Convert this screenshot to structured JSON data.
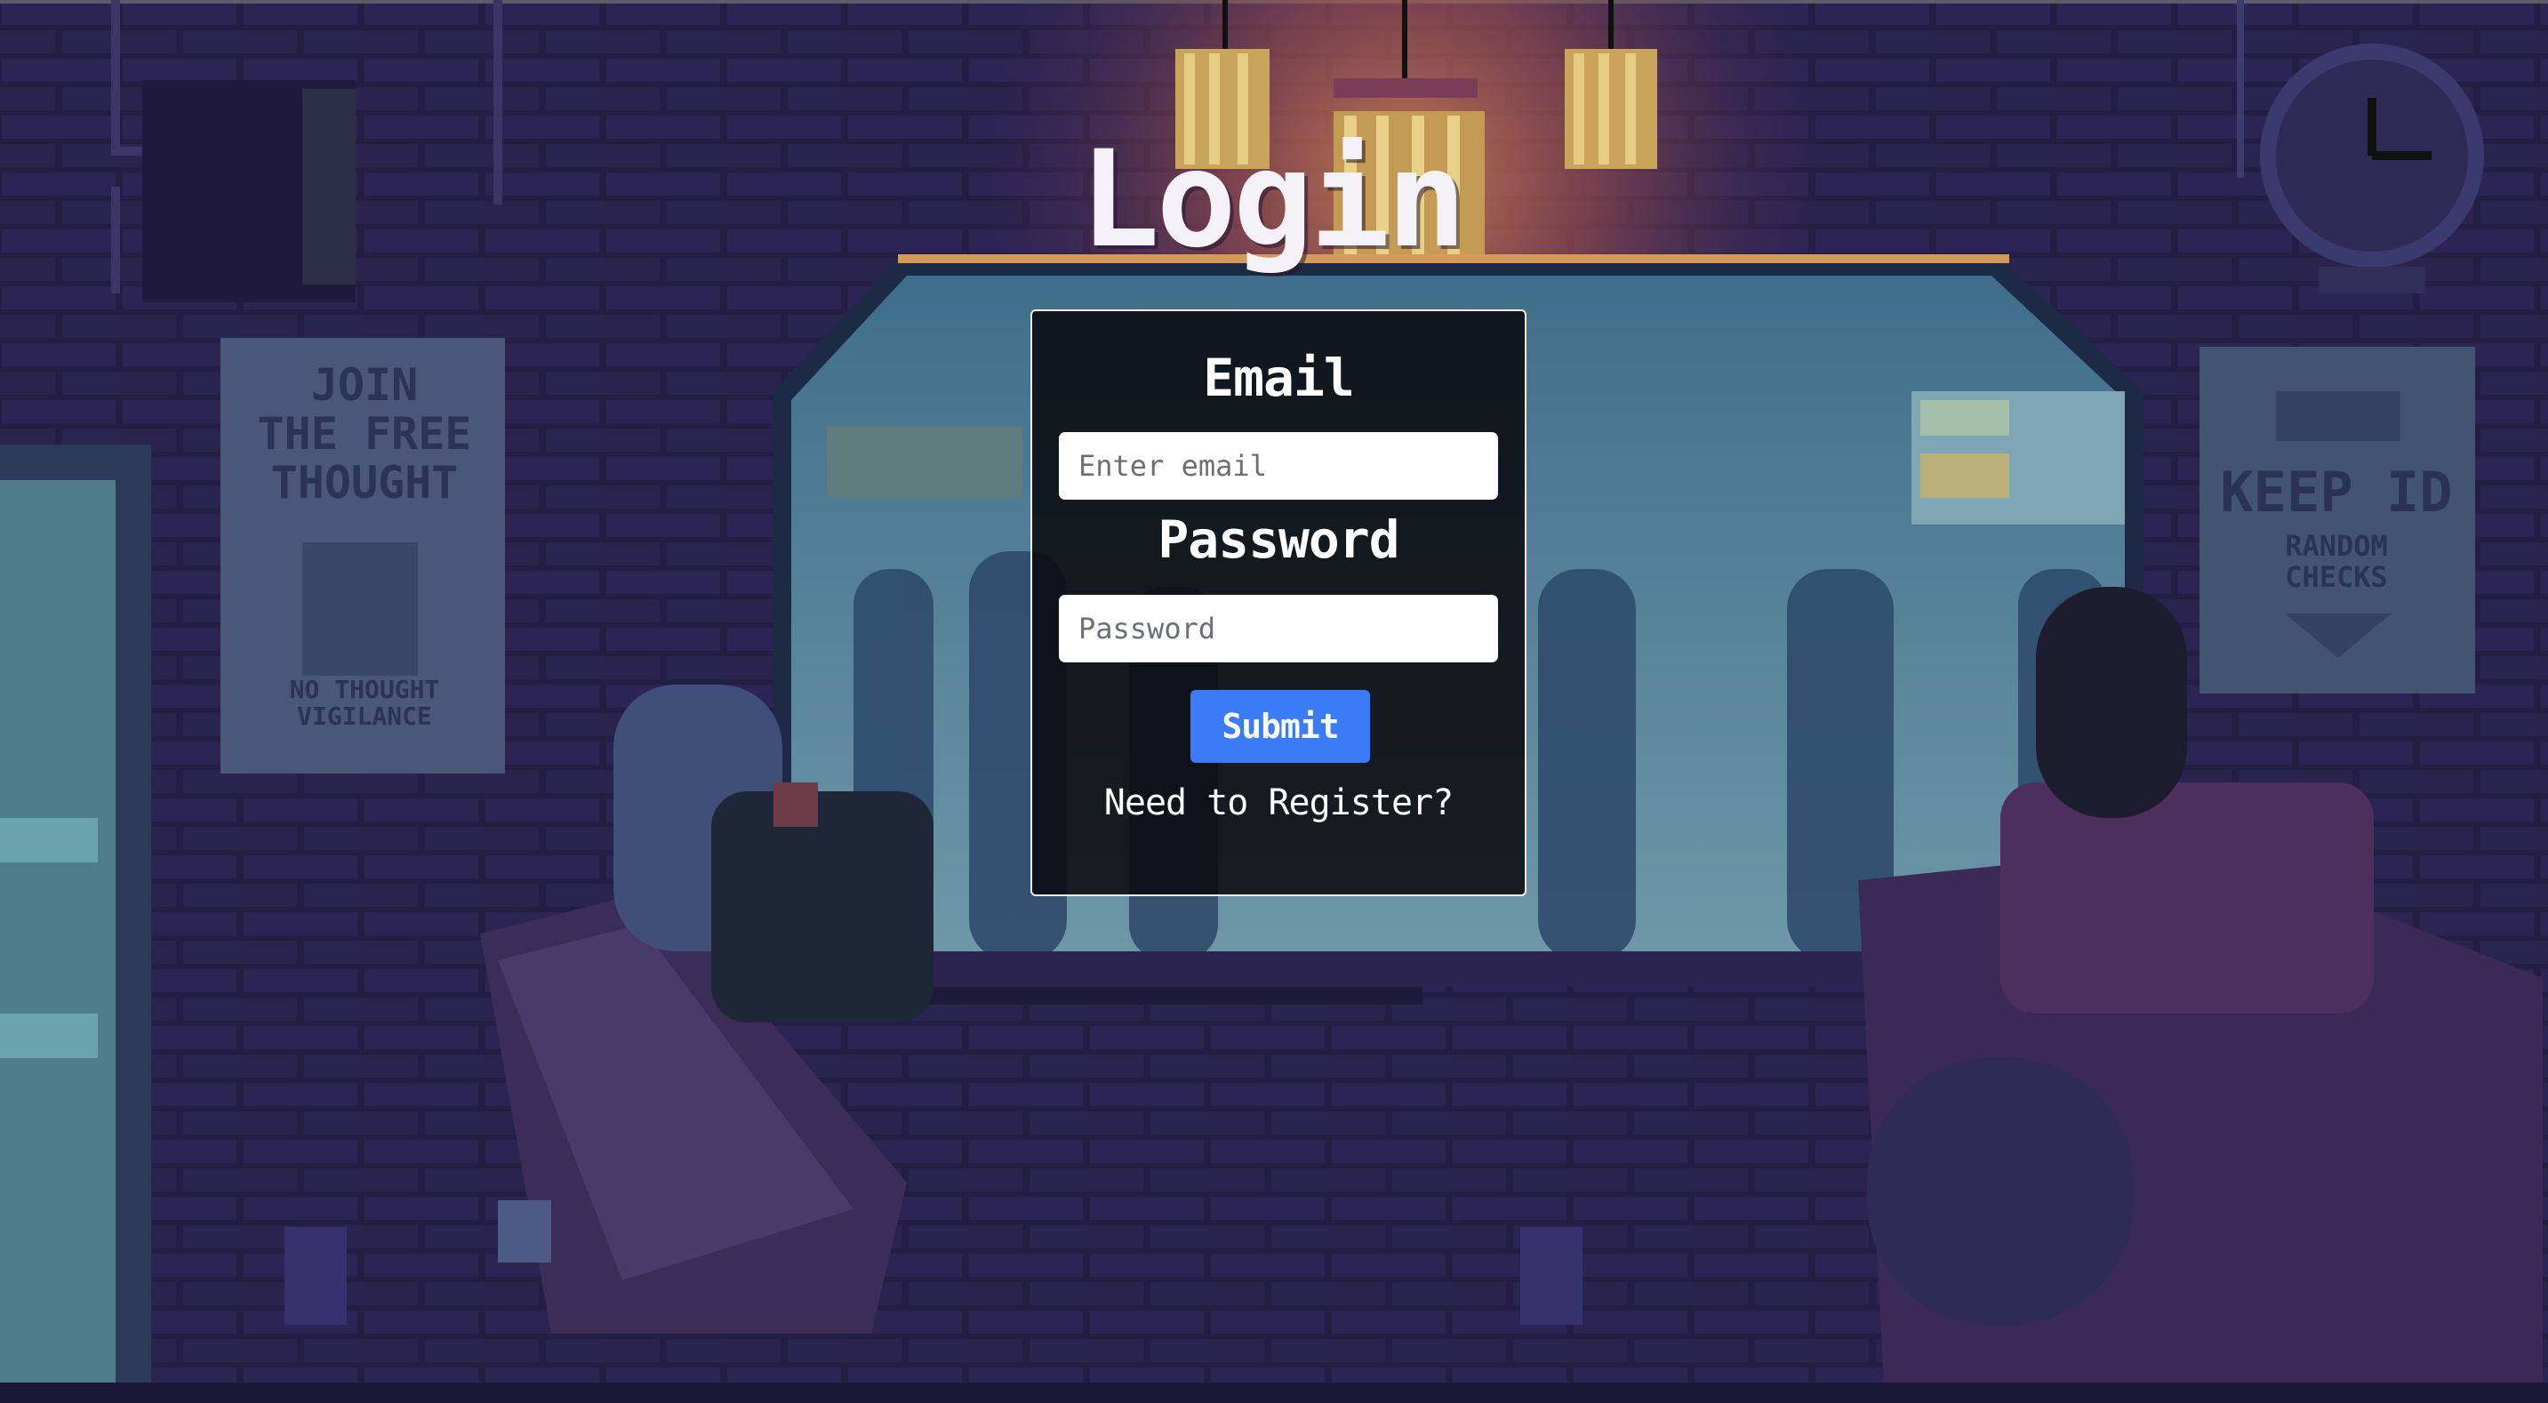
{
  "page": {
    "title": "Login"
  },
  "form": {
    "email_label": "Email",
    "email_placeholder": "Enter email",
    "password_label": "Password",
    "password_placeholder": "Password",
    "submit_label": "Submit",
    "register_link": "Need to Register?"
  },
  "scene": {
    "poster_left_lines": [
      "JOIN",
      "THE FREE",
      "THOUGHT"
    ],
    "poster_left_footer": [
      "NO THOUGHT",
      "VIGILANCE"
    ],
    "poster_right_lines": [
      "KEEP ID",
      "RANDOM",
      "CHECKS"
    ]
  },
  "colors": {
    "accent": "#3a7cf5",
    "card_background": "#08080c",
    "wall": "#221d44",
    "lamp_glow": "#c8684a"
  }
}
